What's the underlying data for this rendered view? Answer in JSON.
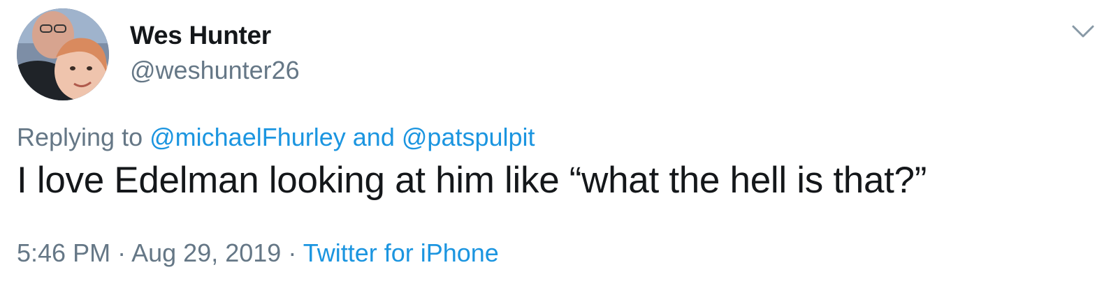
{
  "tweet": {
    "author": {
      "name": "Wes Hunter",
      "handle": "@weshunter26",
      "avatar_icon": "profile-photo"
    },
    "menu_icon": "chevron-down-icon",
    "reply_context": {
      "prefix": "Replying to",
      "mention_1": "@michaelFhurley",
      "conjunction": "and",
      "mention_2": "@patspulpit"
    },
    "text": "I love Edelman looking at him like “what the hell is that?”",
    "meta": {
      "time": "5:46 PM",
      "separator": "·",
      "date": "Aug 29, 2019",
      "source": "Twitter for iPhone"
    },
    "colors": {
      "link": "#1b95e0",
      "secondary_text": "#657786",
      "primary_text": "#14171a"
    }
  }
}
